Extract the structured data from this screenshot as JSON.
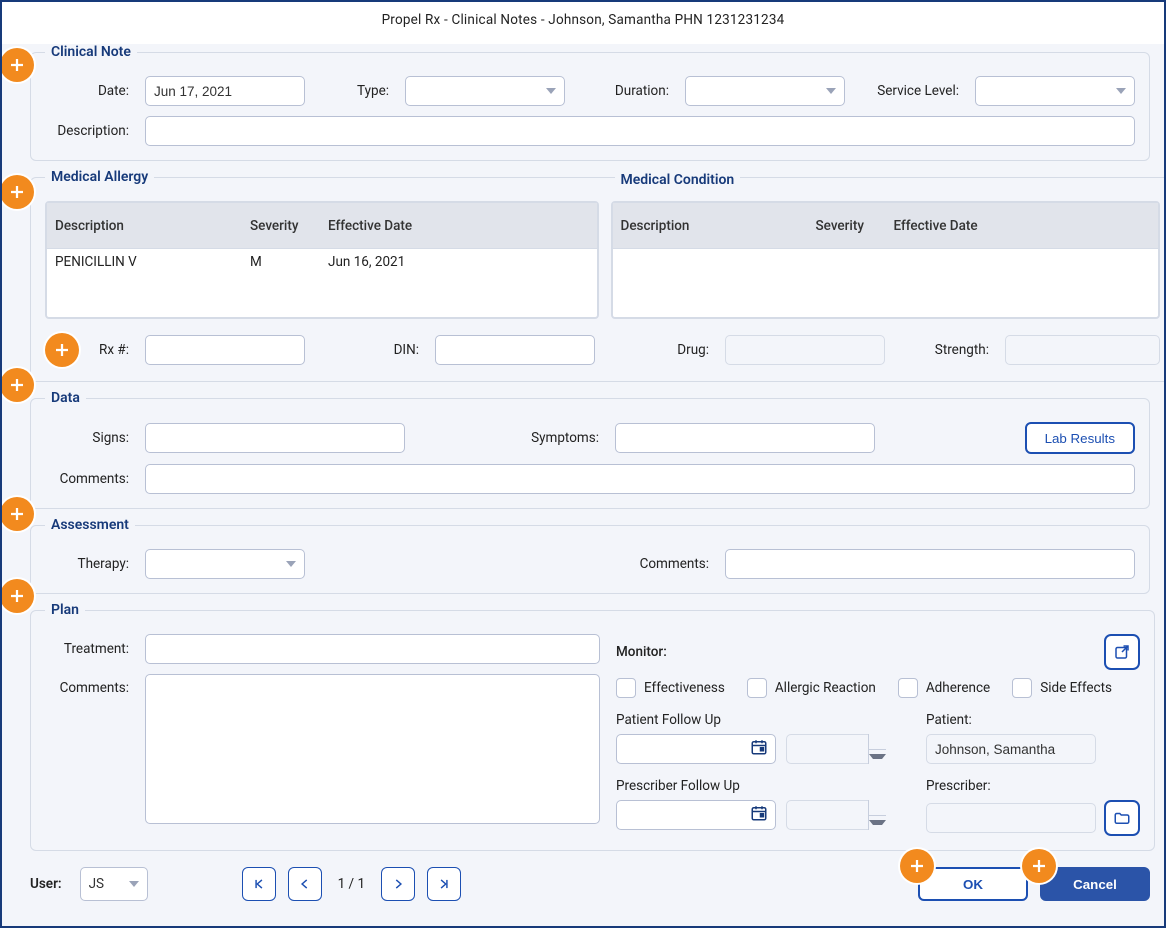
{
  "title": "Propel Rx - Clinical Notes - Johnson, Samantha  PHN 1231231234",
  "clinical_note": {
    "legend": "Clinical Note",
    "date_label": "Date:",
    "date_value": "Jun 17, 2021",
    "type_label": "Type:",
    "duration_label": "Duration:",
    "service_level_label": "Service Level:",
    "description_label": "Description:"
  },
  "allergy": {
    "legend": "Medical Allergy",
    "columns": {
      "desc": "Description",
      "sev": "Severity",
      "eff": "Effective Date"
    },
    "row": {
      "desc": "PENICILLIN V",
      "sev": "M",
      "eff": "Jun 16, 2021"
    }
  },
  "condition": {
    "legend": "Medical Condition",
    "columns": {
      "desc": "Description",
      "sev": "Severity",
      "eff": "Effective Date"
    }
  },
  "rx": {
    "rxnum_label": "Rx #:",
    "din_label": "DIN:",
    "drug_label": "Drug:",
    "strength_label": "Strength:"
  },
  "data": {
    "legend": "Data",
    "signs_label": "Signs:",
    "symptoms_label": "Symptoms:",
    "lab_button": "Lab Results",
    "comments_label": "Comments:"
  },
  "assessment": {
    "legend": "Assessment",
    "therapy_label": "Therapy:",
    "comments_label": "Comments:"
  },
  "plan": {
    "legend": "Plan",
    "treatment_label": "Treatment:",
    "comments_label": "Comments:",
    "monitor_label": "Monitor:",
    "effectiveness": "Effectiveness",
    "allergic": "Allergic Reaction",
    "adherence": "Adherence",
    "side_effects": "Side Effects",
    "patient_followup": "Patient Follow Up",
    "prescriber_followup": "Prescriber Follow Up",
    "patient_label": "Patient:",
    "patient_value": "Johnson, Samantha",
    "prescriber_label": "Prescriber:"
  },
  "footer": {
    "user_label": "User:",
    "user_value": "JS",
    "page": "1 / 1",
    "ok": "OK",
    "cancel": "Cancel"
  }
}
